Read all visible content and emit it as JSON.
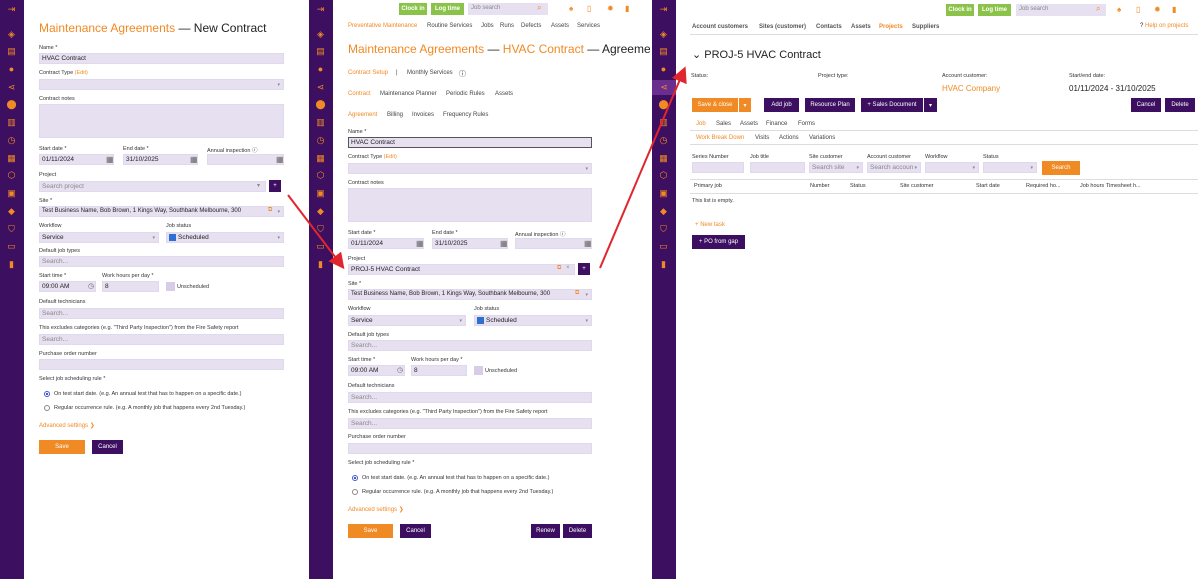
{
  "colors": {
    "sidebar": "#3d0f61",
    "accent": "#f08a24",
    "purple_btn": "#3d0f61",
    "green_btn": "#8bc34a",
    "arrow": "#e0262c"
  },
  "sidebar_icons": [
    "expand-icon",
    "tag-icon",
    "document-icon",
    "person-icon",
    "share-icon",
    "location-icon",
    "chart-icon",
    "clock-icon",
    "clipboard-icon",
    "box-icon",
    "list-icon",
    "tag2-icon",
    "shield-icon",
    "book-icon",
    "note-icon"
  ],
  "p1": {
    "title_orange": "Maintenance Agreements",
    "title_rest": "— New Contract",
    "name_label": "Name *",
    "name_value": "HVAC Contract",
    "contract_type_label": "Contract Type",
    "contract_type_edit": "(Edit)",
    "contract_notes_label": "Contract notes",
    "start_date_label": "Start date *",
    "start_date_value": "01/11/2024",
    "end_date_label": "End date *",
    "end_date_value": "31/10/2025",
    "annual_inspection_label": "Annual inspection",
    "project_label": "Project",
    "project_placeholder": "Search project",
    "site_label": "Site *",
    "site_value": "Test Business Name, Bob Brown, 1 Kings Way, Southbank Melbourne, 300",
    "workflow_label": "Workflow",
    "workflow_value": "Service",
    "job_status_label": "Job status",
    "job_status_value": "Scheduled",
    "default_job_types_label": "Default job types",
    "search_ph": "Search...",
    "start_time_label": "Start time *",
    "start_time_value": "09:00 AM",
    "work_hours_label": "Work hours per day *",
    "work_hours_value": "8",
    "unscheduled_label": "Unscheduled",
    "default_technicians_label": "Default technicians",
    "excludes_label": "This excludes categories (e.g. \"Third Party Inspection\") from the Fire Safety report",
    "po_label": "Purchase order number",
    "rule_label": "Select job scheduling rule *",
    "rule1": "On test start date. (e.g. An annual test that has to happen on a specific date.)",
    "rule2": "Regular occurrence rule. (e.g. A monthly job that happens every 2nd Tuesday.)",
    "advanced": "Advanced settings",
    "save": "Save",
    "cancel": "Cancel"
  },
  "topbar": {
    "clock_in": "Clock in",
    "log_time": "Log time",
    "job_search_ph": "Job search"
  },
  "p2": {
    "top_tabs": [
      "Preventative Maintenance",
      "Routine Services",
      "Jobs",
      "Runs",
      "Defects",
      "Assets",
      "Services"
    ],
    "title_orange": "Maintenance Agreements",
    "title_dash": "—",
    "title_orange2": "HVAC Contract",
    "title_rest": "— Agreement",
    "tabs1": [
      "Contract Setup",
      "Monthly Services"
    ],
    "tabs2": [
      "Contract",
      "Maintenance Planner",
      "Periodic Rules",
      "Assets"
    ],
    "tabs3": [
      "Agreement",
      "Billing",
      "Invoices",
      "Frequency Rules"
    ],
    "project_value": "PROJ-5 HVAC Contract",
    "renew": "Renew",
    "delete": "Delete"
  },
  "p3": {
    "nav": [
      "Account customers",
      "Sites (customer)",
      "Contacts",
      "Assets",
      "Projects",
      "Suppliers"
    ],
    "help": "Help on projects",
    "project_title": "PROJ-5 HVAC Contract",
    "status_label": "Status:",
    "project_type_label": "Project type:",
    "account_customer_label": "Account customer:",
    "account_customer_value": "HVAC Company",
    "start_end_label": "Start/end date:",
    "start_end_value": "01/11/2024 - 31/10/2025",
    "save_close": "Save & close",
    "add_job": "Add job",
    "resource_plan": "Resource Plan",
    "sales_document": "+ Sales Document",
    "cancel": "Cancel",
    "delete": "Delete",
    "tabs": [
      "Job",
      "Sales",
      "Assets",
      "Finance",
      "Forms"
    ],
    "subtabs": [
      "Work Break Down",
      "Visits",
      "Actions",
      "Variations"
    ],
    "filters": [
      "Series Number",
      "Job title",
      "Site customer",
      "Account customer",
      "Workflow",
      "Status"
    ],
    "site_ph": "Search site",
    "account_ph": "Search accoun",
    "search_btn": "Search",
    "columns": [
      "Primary job",
      "Number",
      "Status",
      "Site customer",
      "Start date",
      "Required ho...",
      "Job hours",
      "Timesheet h..."
    ],
    "empty": "This list is empty.",
    "new_task": "New task",
    "po_from_gap": "+ PO from gap"
  }
}
